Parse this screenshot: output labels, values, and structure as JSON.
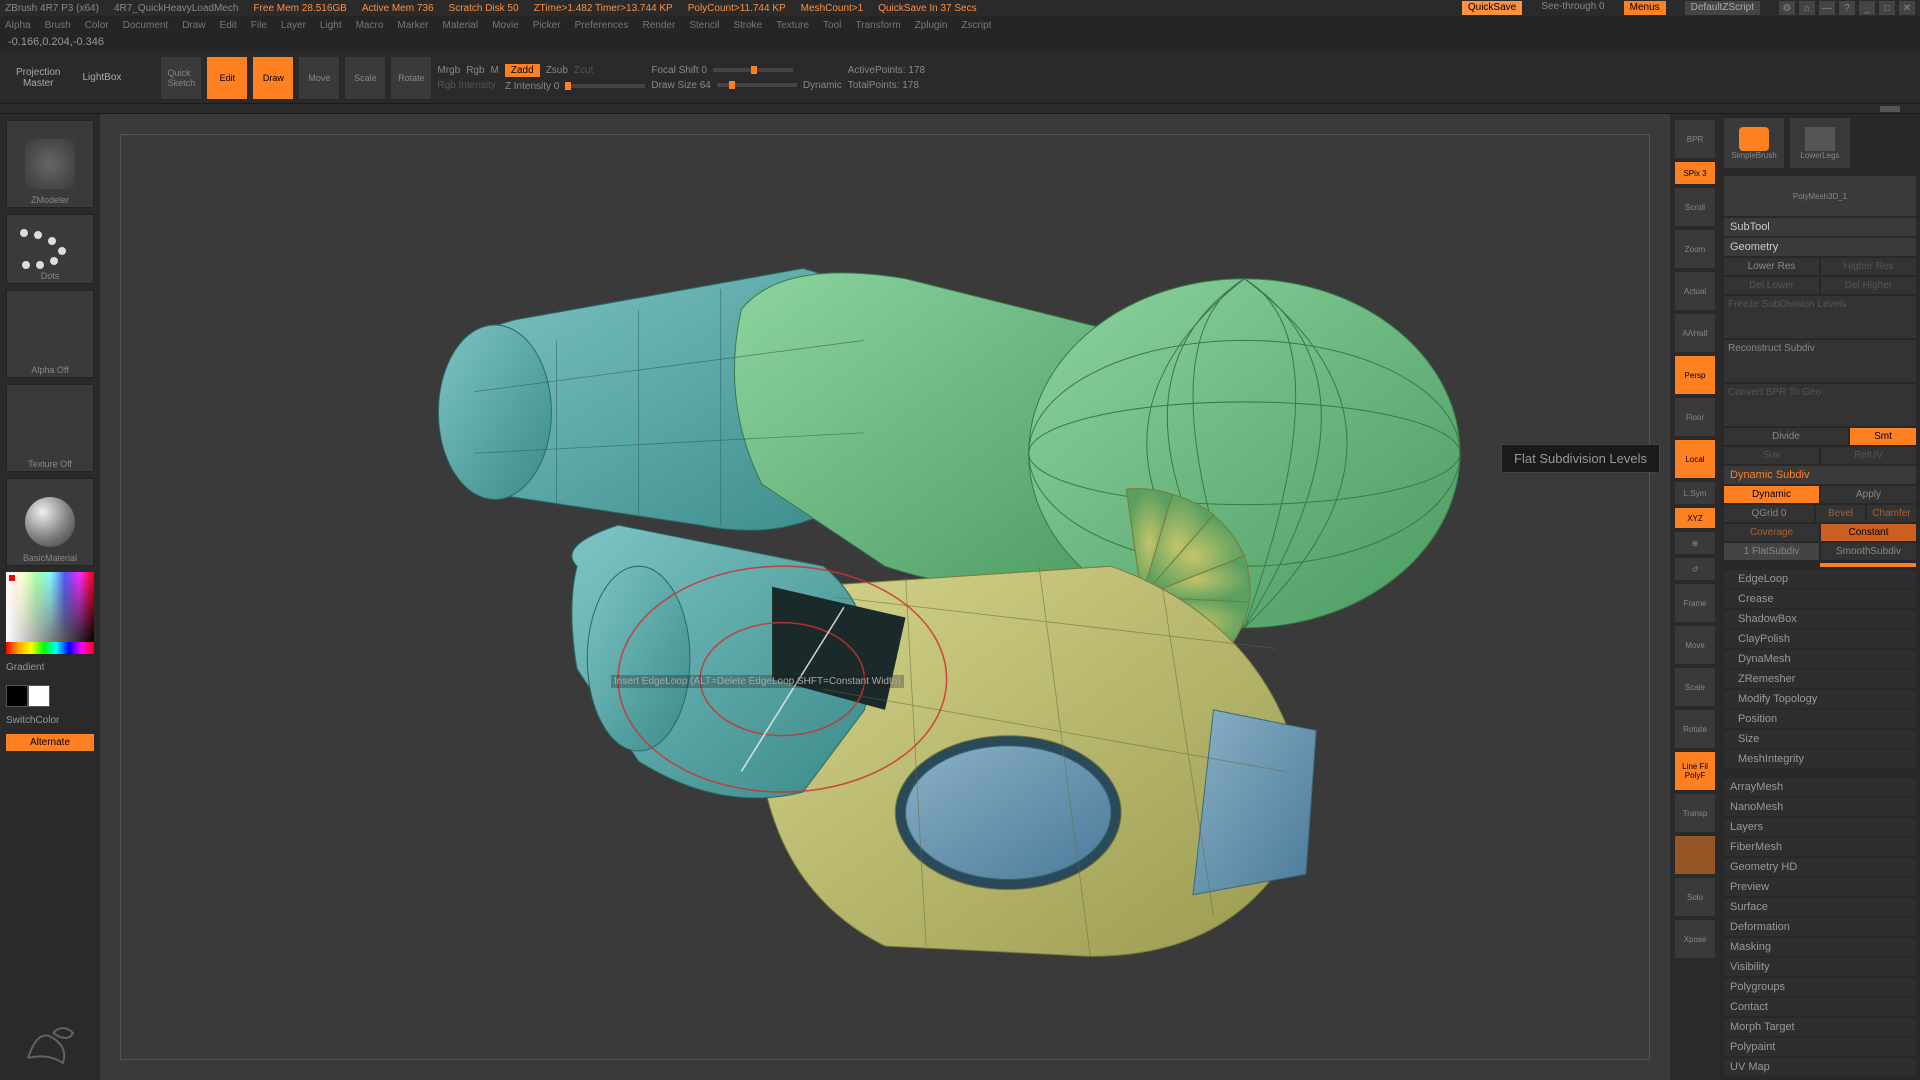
{
  "title": {
    "app": "ZBrush 4R7 P3 (x64)",
    "doc": "4R7_QuickHeavyLoadMech",
    "mem": "Free Mem 28.516GB",
    "active": "Active Mem 736",
    "scratch": "Scratch Disk 50",
    "ztime": "ZTime>1.482 Timer>13.744 KP",
    "poly": "PolyCount>11.744 KP",
    "mesh": "MeshCount>1",
    "qs": "QuickSave In 37 Secs",
    "quicksave": "QuickSave",
    "seethrough": "See-through  0",
    "menus": "Menus",
    "script": "DefaultZScript"
  },
  "menu": [
    "Alpha",
    "Brush",
    "Color",
    "Document",
    "Draw",
    "Edit",
    "File",
    "Layer",
    "Light",
    "Macro",
    "Marker",
    "Material",
    "Movie",
    "Picker",
    "Preferences",
    "Render",
    "Stencil",
    "Stroke",
    "Texture",
    "Tool",
    "Transform",
    "Zplugin",
    "Zscript"
  ],
  "status": "-0.166,0.204,-0.346",
  "toolbar": {
    "proj": "Projection\nMaster",
    "lightbox": "LightBox",
    "quicksketch": "Quick\nSketch",
    "edit": "Edit",
    "draw": "Draw",
    "move": "Move",
    "scale": "Scale",
    "rotate": "Rotate",
    "mrgb": "Mrgb",
    "rgb": "Rgb",
    "m": "M",
    "rgbint": "Rgb Intensity",
    "zadd": "Zadd",
    "zsub": "Zsub",
    "zcut": "Zcut",
    "zint": "Z Intensity 0",
    "focal": "Focal Shift 0",
    "drawsize": "Draw Size 64",
    "dynamic": "Dynamic",
    "active": "ActivePoints: 178",
    "total": "TotalPoints: 178"
  },
  "left": {
    "zmodeler": "ZModeler",
    "dots": "Dots",
    "alpha": "Alpha Off",
    "texture": "Texture Off",
    "material": "BasicMaterial",
    "gradient": "Gradient",
    "switchcolor": "SwitchColor",
    "alternate": "Alternate"
  },
  "cursor_hint": "Insert EdgeLoop (ALT=Delete EdgeLoop SHFT=Constant Width)",
  "tooltip": "Flat Subdivision Levels",
  "right_icons": {
    "bpr": "BPR",
    "spix": "SPix 3",
    "scroll": "Scroll",
    "zoom": "Zoom",
    "actual": "Actual",
    "aahalf": "AAHalf",
    "persp": "Persp",
    "floor": "Floor",
    "local": "Local",
    "lsym": "L.Sym",
    "xyz": "XYZ",
    "frame": "Frame",
    "move": "Move",
    "scale": "Scale",
    "rotate": "Rotate",
    "linefill": "Line Fil",
    "polyf": "PolyF",
    "transp": "Transp",
    "solo": "Solo",
    "xpose": "Xpose"
  },
  "brushes": {
    "simple": "SimpleBrush",
    "lower": "LowerLegs",
    "polymesh": "PolyMesh3D_1"
  },
  "panel": {
    "subtool": "SubTool",
    "geometry": "Geometry",
    "lower_res": "Lower Res",
    "higher_res": "Higher Res",
    "del_lower": "Del Lower",
    "del_higher": "Del Higher",
    "freeze_sub": "Freeze SubDivision Levels",
    "reconstruct": "Reconstruct Subdiv",
    "convert": "Convert BPR To Geo",
    "divide": "Divide",
    "smt": "Smt",
    "suv": "Suv",
    "reluv": "RelUV",
    "dynamic_sub": "Dynamic Subdiv",
    "dynamic": "Dynamic",
    "apply": "Apply",
    "qgrid": "QGrid 0",
    "bevel": "Bevel",
    "chamfer": "Chamfer",
    "coverage": "Coverage",
    "constant": "Constant",
    "flatsubdiv": "1 FlatSubdiv",
    "smoothsubdiv": "SmoothSubdiv",
    "edgeloop": "EdgeLoop",
    "crease": "Crease",
    "shadowbox": "ShadowBox",
    "claypolish": "ClayPolish",
    "dynamesh": "DynaMesh",
    "zremesher": "ZRemesher",
    "modify_topology": "Modify Topology",
    "position": "Position",
    "size": "Size",
    "meshintegrity": "MeshIntegrity",
    "arraymesh": "ArrayMesh",
    "nanomesh": "NanoMesh",
    "layers": "Layers",
    "fibermesh": "FiberMesh",
    "geometry_hd": "Geometry HD",
    "preview": "Preview",
    "surface": "Surface",
    "deformation": "Deformation",
    "masking": "Masking",
    "visibility": "Visibility",
    "polygroups": "Polygroups",
    "contact": "Contact",
    "morph_target": "Morph Target",
    "polypaint": "Polypaint",
    "uvmap": "UV Map"
  }
}
